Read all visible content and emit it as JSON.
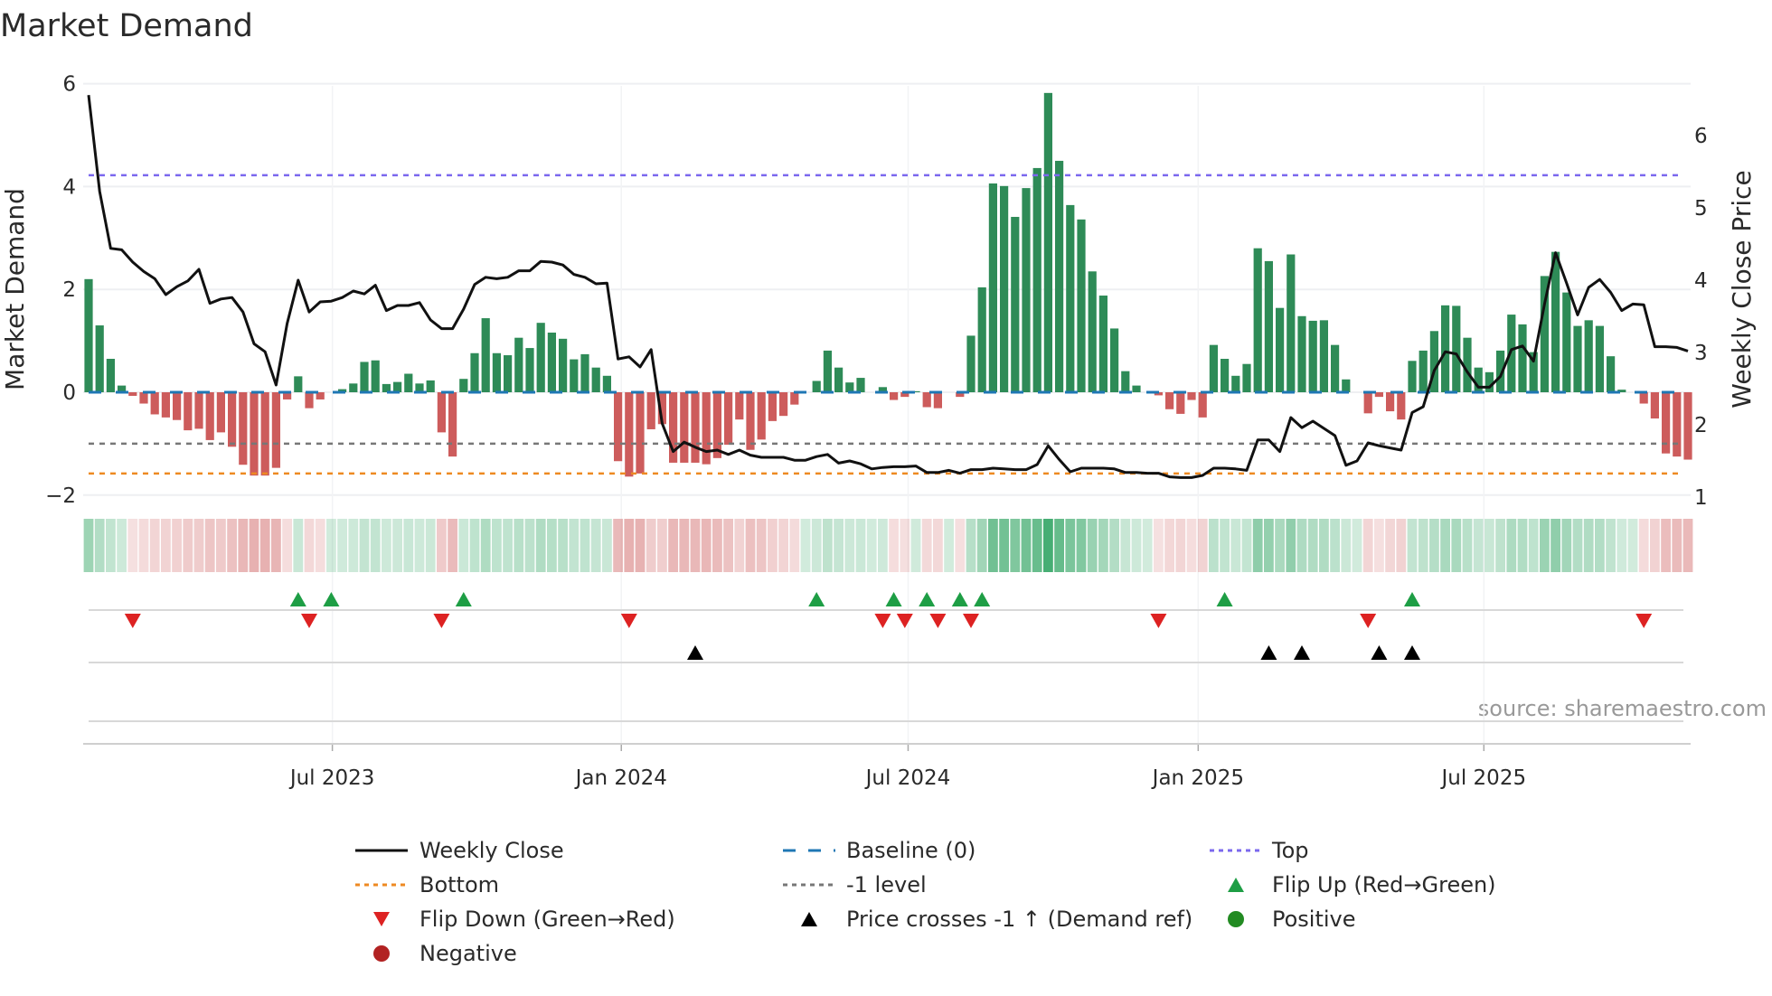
{
  "chart_data": {
    "type": "bar",
    "title": "Market Demand",
    "ylabel": "Market Demand",
    "y2label": "Weekly Close Price",
    "source": "source: sharemaestro.com",
    "ylim": [
      -2.2,
      6.2
    ],
    "y2lim": [
      0.75,
      6.8
    ],
    "yticks": [
      -2,
      0,
      2,
      4,
      6
    ],
    "ytick_labels": [
      "−2",
      "0",
      "2",
      "4",
      "6"
    ],
    "y2ticks": [
      1,
      2,
      3,
      4,
      5,
      6
    ],
    "y2tick_labels": [
      "1",
      "2",
      "3",
      "4",
      "5",
      "6"
    ],
    "xticks": [
      {
        "label": "Jul 2023",
        "week": 23.1
      },
      {
        "label": "Jan 2024",
        "week": 49.3
      },
      {
        "label": "Jul 2024",
        "week": 75.3
      },
      {
        "label": "Jan 2025",
        "week": 101.6
      },
      {
        "label": "Jul 2025",
        "week": 127.5
      }
    ],
    "levels": {
      "top": 4.22,
      "bottom": -1.58,
      "minus_one": -1,
      "baseline": 0
    },
    "demand": [
      2.2,
      1.3,
      0.65,
      0.13,
      -0.07,
      -0.22,
      -0.43,
      -0.49,
      -0.54,
      -0.74,
      -0.71,
      -0.93,
      -0.78,
      -1.06,
      -1.41,
      -1.62,
      -1.62,
      -1.47,
      -0.14,
      0.31,
      -0.31,
      -0.14,
      0,
      0.06,
      0.17,
      0.59,
      0.62,
      0.16,
      0.2,
      0.36,
      0.17,
      0.23,
      -0.78,
      -1.25,
      0.26,
      0.76,
      1.44,
      0.76,
      0.72,
      1.06,
      0.86,
      1.35,
      1.16,
      1.04,
      0.64,
      0.74,
      0.48,
      0.32,
      -1.34,
      -1.64,
      -1.58,
      -0.72,
      -0.62,
      -1.37,
      -1.37,
      -1.37,
      -1.4,
      -1.28,
      -1.02,
      -0.53,
      -1.12,
      -0.92,
      -0.56,
      -0.46,
      -0.24,
      0,
      0.22,
      0.81,
      0.48,
      0.19,
      0.28,
      0,
      0.1,
      -0.15,
      -0.09,
      0.02,
      -0.29,
      -0.31,
      0,
      -0.09,
      1.1,
      2.04,
      4.06,
      4.01,
      3.41,
      3.97,
      4.36,
      5.82,
      4.5,
      3.64,
      3.36,
      2.35,
      1.88,
      1.24,
      0.41,
      0.13,
      0,
      -0.06,
      -0.33,
      -0.42,
      -0.15,
      -0.49,
      0.92,
      0.65,
      0.32,
      0.55,
      2.8,
      2.55,
      1.64,
      2.68,
      1.48,
      1.39,
      1.4,
      0.92,
      0.25,
      0,
      -0.41,
      -0.09,
      -0.37,
      -0.53,
      0.61,
      0.81,
      1.19,
      1.69,
      1.68,
      1.06,
      0.48,
      0.39,
      0.81,
      1.51,
      1.32,
      0.78,
      2.26,
      2.73,
      1.94,
      1.29,
      1.4,
      1.29,
      0.7,
      0.05,
      0,
      -0.22,
      -0.51,
      -1.19,
      -1.25,
      -1.31
    ],
    "weekly_close": [
      6.56,
      5.23,
      4.44,
      4.42,
      4.25,
      4.12,
      4.02,
      3.8,
      3.91,
      3.99,
      4.15,
      3.68,
      3.74,
      3.76,
      3.56,
      3.12,
      3.01,
      2.55,
      3.4,
      4.0,
      3.56,
      3.7,
      3.71,
      3.76,
      3.85,
      3.81,
      3.93,
      3.58,
      3.65,
      3.65,
      3.69,
      3.45,
      3.33,
      3.33,
      3.6,
      3.94,
      4.04,
      4.02,
      4.04,
      4.13,
      4.13,
      4.26,
      4.25,
      4.21,
      4.08,
      4.04,
      3.95,
      3.96,
      2.91,
      2.94,
      2.8,
      3.04,
      2.02,
      1.63,
      1.76,
      1.69,
      1.63,
      1.65,
      1.59,
      1.65,
      1.58,
      1.55,
      1.55,
      1.55,
      1.51,
      1.51,
      1.56,
      1.59,
      1.47,
      1.5,
      1.46,
      1.39,
      1.41,
      1.42,
      1.42,
      1.43,
      1.34,
      1.34,
      1.37,
      1.33,
      1.38,
      1.38,
      1.4,
      1.39,
      1.38,
      1.38,
      1.45,
      1.71,
      1.52,
      1.35,
      1.4,
      1.4,
      1.4,
      1.39,
      1.34,
      1.34,
      1.33,
      1.33,
      1.28,
      1.27,
      1.27,
      1.3,
      1.4,
      1.4,
      1.39,
      1.37,
      1.79,
      1.79,
      1.63,
      2.1,
      1.96,
      2.05,
      1.95,
      1.85,
      1.44,
      1.5,
      1.75,
      1.71,
      1.68,
      1.65,
      2.17,
      2.25,
      2.75,
      3.01,
      2.98,
      2.73,
      2.52,
      2.52,
      2.67,
      3.04,
      3.09,
      2.88,
      3.67,
      4.38,
      3.96,
      3.52,
      3.9,
      4.01,
      3.83,
      3.58,
      3.67,
      3.66,
      3.08,
      3.08,
      3.07,
      3.02
    ],
    "flip_up_weeks": [
      20,
      23,
      35,
      67,
      74,
      77,
      80,
      82,
      104,
      121
    ],
    "flip_down_weeks": [
      5,
      21,
      33,
      50,
      73,
      75,
      78,
      81,
      98,
      117,
      142
    ],
    "price_cross_weeks": [
      56,
      108,
      111,
      118,
      121
    ],
    "legend": [
      {
        "label": "Weekly Close",
        "kind": "line"
      },
      {
        "label": "Baseline (0)",
        "kind": "dash"
      },
      {
        "label": "Top",
        "kind": "dotpurple"
      },
      {
        "label": "Bottom",
        "kind": "dotorange"
      },
      {
        "label": "-1 level",
        "kind": "dotgray"
      },
      {
        "label": "Flip Up (Red→Green)",
        "kind": "tri-up-green"
      },
      {
        "label": "Flip Down (Green→Red)",
        "kind": "tri-down-red"
      },
      {
        "label": "Price crosses -1 ↑ (Demand ref)",
        "kind": "tri-up-black"
      },
      {
        "label": "Positive",
        "kind": "dot-green"
      },
      {
        "label": "Negative",
        "kind": "dot-red"
      }
    ],
    "colors": {
      "positive_bar": "#2e8b57",
      "negative_bar": "#cd5c5c",
      "price_line": "#111111",
      "baseline": "#1f77b4",
      "top": "#7b68ee",
      "bottom": "#ee8a22",
      "minus_one": "#777777",
      "flip_up": "#1e9e45",
      "flip_down": "#dd2222",
      "cross": "#000000",
      "positive_dot": "#228b22",
      "negative_dot": "#b22222"
    }
  }
}
